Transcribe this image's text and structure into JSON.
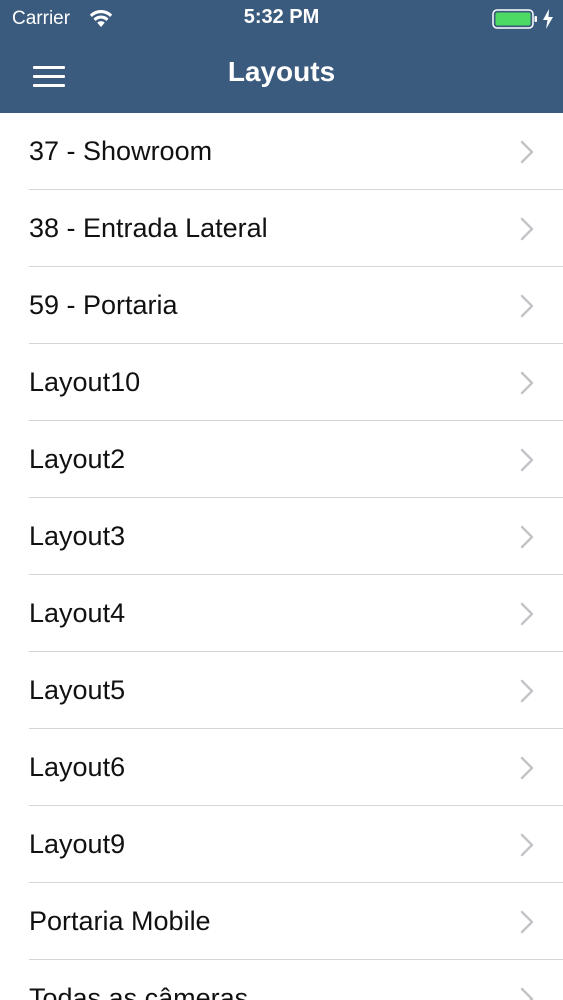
{
  "status_bar": {
    "carrier": "Carrier",
    "time": "5:32 PM",
    "wifi_icon": "wifi-icon",
    "battery_icon": "battery-icon",
    "battery_color": "#4cd964"
  },
  "nav": {
    "title": "Layouts",
    "menu_icon": "hamburger-menu-icon",
    "bar_color": "#3a5a7e"
  },
  "list": {
    "items": [
      {
        "label": "37 - Showroom"
      },
      {
        "label": "38 - Entrada Lateral"
      },
      {
        "label": "59 - Portaria"
      },
      {
        "label": "Layout10"
      },
      {
        "label": "Layout2"
      },
      {
        "label": "Layout3"
      },
      {
        "label": "Layout4"
      },
      {
        "label": "Layout5"
      },
      {
        "label": "Layout6"
      },
      {
        "label": "Layout9"
      },
      {
        "label": "Portaria Mobile"
      },
      {
        "label": "Todas as câmeras"
      }
    ],
    "chevron_icon": "chevron-right-icon"
  }
}
